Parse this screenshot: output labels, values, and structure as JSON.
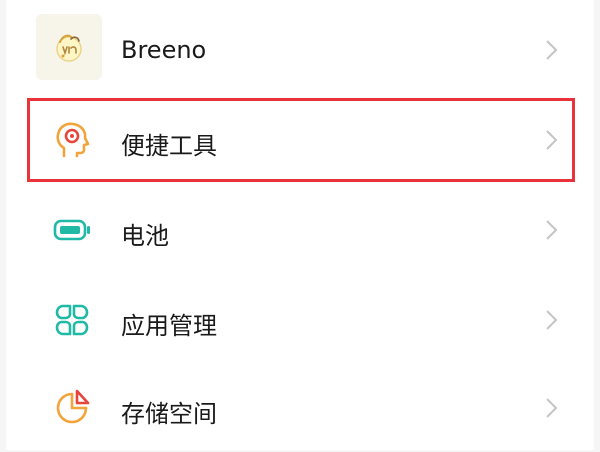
{
  "settings_list": {
    "items": [
      {
        "label": "Breeno",
        "icon": "breeno-logo-icon"
      },
      {
        "label": "便捷工具",
        "icon": "head-gear-icon"
      },
      {
        "label": "电池",
        "icon": "battery-icon"
      },
      {
        "label": "应用管理",
        "icon": "app-grid-icon"
      },
      {
        "label": "存储空间",
        "icon": "storage-pie-icon"
      }
    ]
  },
  "colors": {
    "highlight": "#e8333a",
    "teal": "#1fb9a5",
    "orange": "#f28c2c",
    "chevron": "#c4c4c4"
  }
}
